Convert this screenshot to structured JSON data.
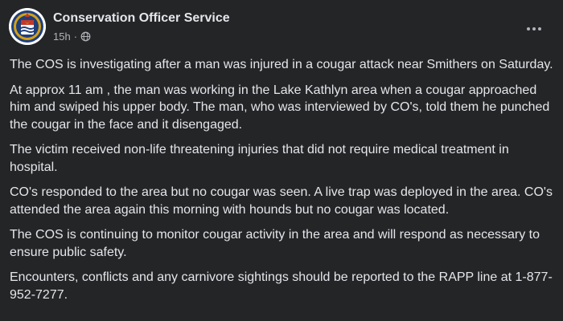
{
  "post": {
    "page_name": "Conservation Officer Service",
    "timestamp": "15h",
    "separator": "·",
    "privacy_icon": "globe-icon",
    "more_icon": "more-options-icon",
    "avatar_icon": "conservation-officer-badge-icon",
    "paragraphs": [
      "The COS is investigating after a man was injured in a cougar attack near Smithers on Saturday.",
      "At approx 11 am , the man was working in the Lake Kathlyn area when a cougar approached him and swiped his upper body. The man, who was interviewed by CO's, told them  he punched the cougar in the face and it disengaged.",
      "The victim received non-life threatening injuries that did not require  medical treatment in hospital.",
      "CO's  responded to the area but no cougar was seen.  A live trap was deployed in the area. CO's attended the area again this morning with hounds but no cougar was located.",
      "The COS is continuing to monitor cougar activity in the area and will respond as necessary to ensure public safety.",
      "Encounters, conflicts and any carnivore sightings should be reported to the RAPP line at 1-877-952-7277."
    ]
  },
  "colors": {
    "background": "#242526",
    "primary_text": "#e4e6eb",
    "secondary_text": "#b0b3b8"
  }
}
